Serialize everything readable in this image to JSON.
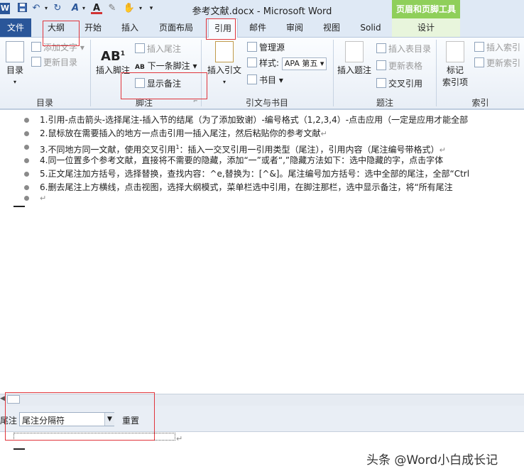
{
  "window": {
    "title": "参考文献.docx - Microsoft Word",
    "tool_tab_group": "页眉和页脚工具"
  },
  "qat": {
    "word_glyph": "W",
    "a_glyph": "A",
    "font_color_glyph": "A"
  },
  "tabs": {
    "file": "文件",
    "outline": "大纲",
    "home": "开始",
    "insert": "插入",
    "layout": "页面布局",
    "references": "引用",
    "mailings": "邮件",
    "review": "审阅",
    "view": "视图",
    "solid": "Solid",
    "design": "设计"
  },
  "ribbon": {
    "toc": {
      "toc_button": "目录",
      "add_text": "添加文字",
      "update_toc": "更新目录",
      "group": "目录"
    },
    "footnotes": {
      "insert_footnote_line1": "插入脚注",
      "ab_glyph": "AB",
      "insert_endnote": "插入尾注",
      "next_footnote": "下一条脚注",
      "show_notes": "显示备注",
      "group": "脚注"
    },
    "citations": {
      "insert_citation": "插入引文",
      "manage_sources": "管理源",
      "style_label": "样式:",
      "style_value": "APA 第五",
      "bibliography": "书目",
      "group": "引文与书目"
    },
    "captions": {
      "insert_caption": "插入题注",
      "insert_table_of_figures": "插入表目录",
      "update_table": "更新表格",
      "cross_reference": "交叉引用",
      "group": "题注"
    },
    "index": {
      "mark_entry_line1": "标记",
      "mark_entry_line2": "索引项",
      "insert_index": "插入索引",
      "update_index": "更新索引",
      "group": "索引"
    }
  },
  "document": {
    "lines": [
      "1.引用-点击箭头-选择尾注-插入节的结尾（为了添加致谢）-编号格式（1,2,3,4）-点击应用（一定是应用才能全部",
      "2.鼠标放在需要插入的地方一点击引用一插入尾注，然后粘贴你的参考文献",
      "3.不同地方同一文献，使用交叉引用",
      "4.同一位置多个参考文献，直接将不需要的隐藏，添加“一”或者“,”隐藏方法如下：选中隐藏的字，点击字体",
      "5.正文尾注加方括号，选择替换，查找内容：^e,替换为：[^&]。尾注编号加方括号：选中全部的尾注，全部“Ctrl",
      "6.删去尾注上方横线，点击视图，选择大纲模式，菜单栏选中引用，在脚注那栏，选中显示备注，将“所有尾注"
    ],
    "line3_superscript": "1",
    "line3_rest": "：插入一交叉引用一引用类型（尾注），引用内容（尾注编号带格式）",
    "para_mark": "↵"
  },
  "footnote_pane": {
    "label": "尾注",
    "selector_value": "尾注分隔符",
    "reset_button": "重置"
  },
  "watermark": "头条 @Word小白成长记"
}
